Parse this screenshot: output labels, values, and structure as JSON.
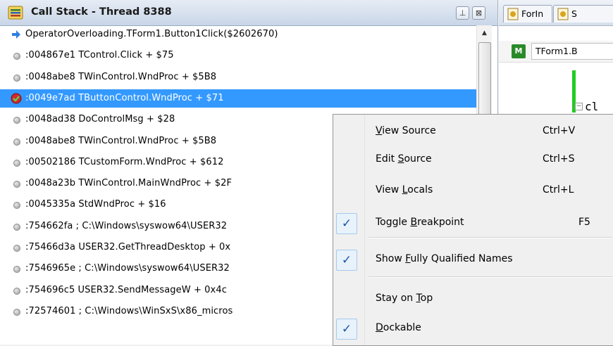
{
  "panel": {
    "title": "Call Stack - Thread 8388",
    "pin_glyph": "⊥",
    "close_glyph": "⊠"
  },
  "stack": [
    {
      "text": "OperatorOverloading.TForm1.Button1Click($2602670)",
      "icon": "current-frame-arrow-icon"
    },
    {
      "text": ":004867e1 TControl.Click + $75",
      "icon": "frame-dot-icon"
    },
    {
      "text": ":0048abe8 TWinControl.WndProc + $5B8",
      "icon": "frame-dot-icon"
    },
    {
      "text": ":0049e7ad TButtonControl.WndProc + $71",
      "icon": "breakpoint-icon",
      "selected": true
    },
    {
      "text": ":0048ad38 DoControlMsg + $28",
      "icon": "frame-dot-icon"
    },
    {
      "text": ":0048abe8 TWinControl.WndProc + $5B8",
      "icon": "frame-dot-icon"
    },
    {
      "text": ":00502186 TCustomForm.WndProc + $612",
      "icon": "frame-dot-icon"
    },
    {
      "text": ":0048a23b TWinControl.MainWndProc + $2F",
      "icon": "frame-dot-icon"
    },
    {
      "text": ":0045335a StdWndProc + $16",
      "icon": "frame-dot-icon"
    },
    {
      "text": ":754662fa ; C:\\Windows\\syswow64\\USER32",
      "icon": "frame-dot-icon"
    },
    {
      "text": ":75466d3a USER32.GetThreadDesktop + 0x",
      "icon": "frame-dot-icon"
    },
    {
      "text": ":7546965e ; C:\\Windows\\syswow64\\USER32",
      "icon": "frame-dot-icon"
    },
    {
      "text": ":754696c5 USER32.SendMessageW + 0x4c",
      "icon": "frame-dot-icon"
    },
    {
      "text": ":72574601 ; C:\\Windows\\WinSxS\\x86_micros",
      "icon": "frame-dot-icon"
    }
  ],
  "scrollbar": {
    "up_glyph": "▲"
  },
  "editor": {
    "tabs": [
      {
        "label": "ForIn",
        "icon": "unit-file-icon"
      },
      {
        "label": "S",
        "icon": "unit-file-icon"
      }
    ],
    "method_badge": "M",
    "method_combo": "TForm1.B",
    "code_fragment": "cl",
    "fold_glyph": "−"
  },
  "context_menu": {
    "items": [
      {
        "label_pre": "",
        "accel": "V",
        "label_post": "iew Source",
        "shortcut": "Ctrl+V",
        "checked": false
      },
      {
        "label_pre": "Edit ",
        "accel": "S",
        "label_post": "ource",
        "shortcut": "Ctrl+S",
        "checked": false
      },
      {
        "label_pre": "View ",
        "accel": "L",
        "label_post": "ocals",
        "shortcut": "Ctrl+L",
        "checked": false
      },
      {
        "label_pre": "Toggle ",
        "accel": "B",
        "label_post": "reakpoint",
        "shortcut": "F5",
        "checked": true
      },
      {
        "label_pre": "Show ",
        "accel": "F",
        "label_post": "ully Qualified Names",
        "shortcut": "",
        "checked": true
      },
      {
        "label_pre": "Stay on ",
        "accel": "T",
        "label_post": "op",
        "shortcut": "",
        "checked": false
      },
      {
        "label_pre": "",
        "accel": "D",
        "label_post": "ockable",
        "shortcut": "",
        "checked": true
      }
    ],
    "check_glyph": "✓"
  },
  "colors": {
    "selection": "#3399ff",
    "current_arrow": "#2f7fe0",
    "breakpoint": "#d0282e",
    "gutter_modified": "#22cc22"
  }
}
